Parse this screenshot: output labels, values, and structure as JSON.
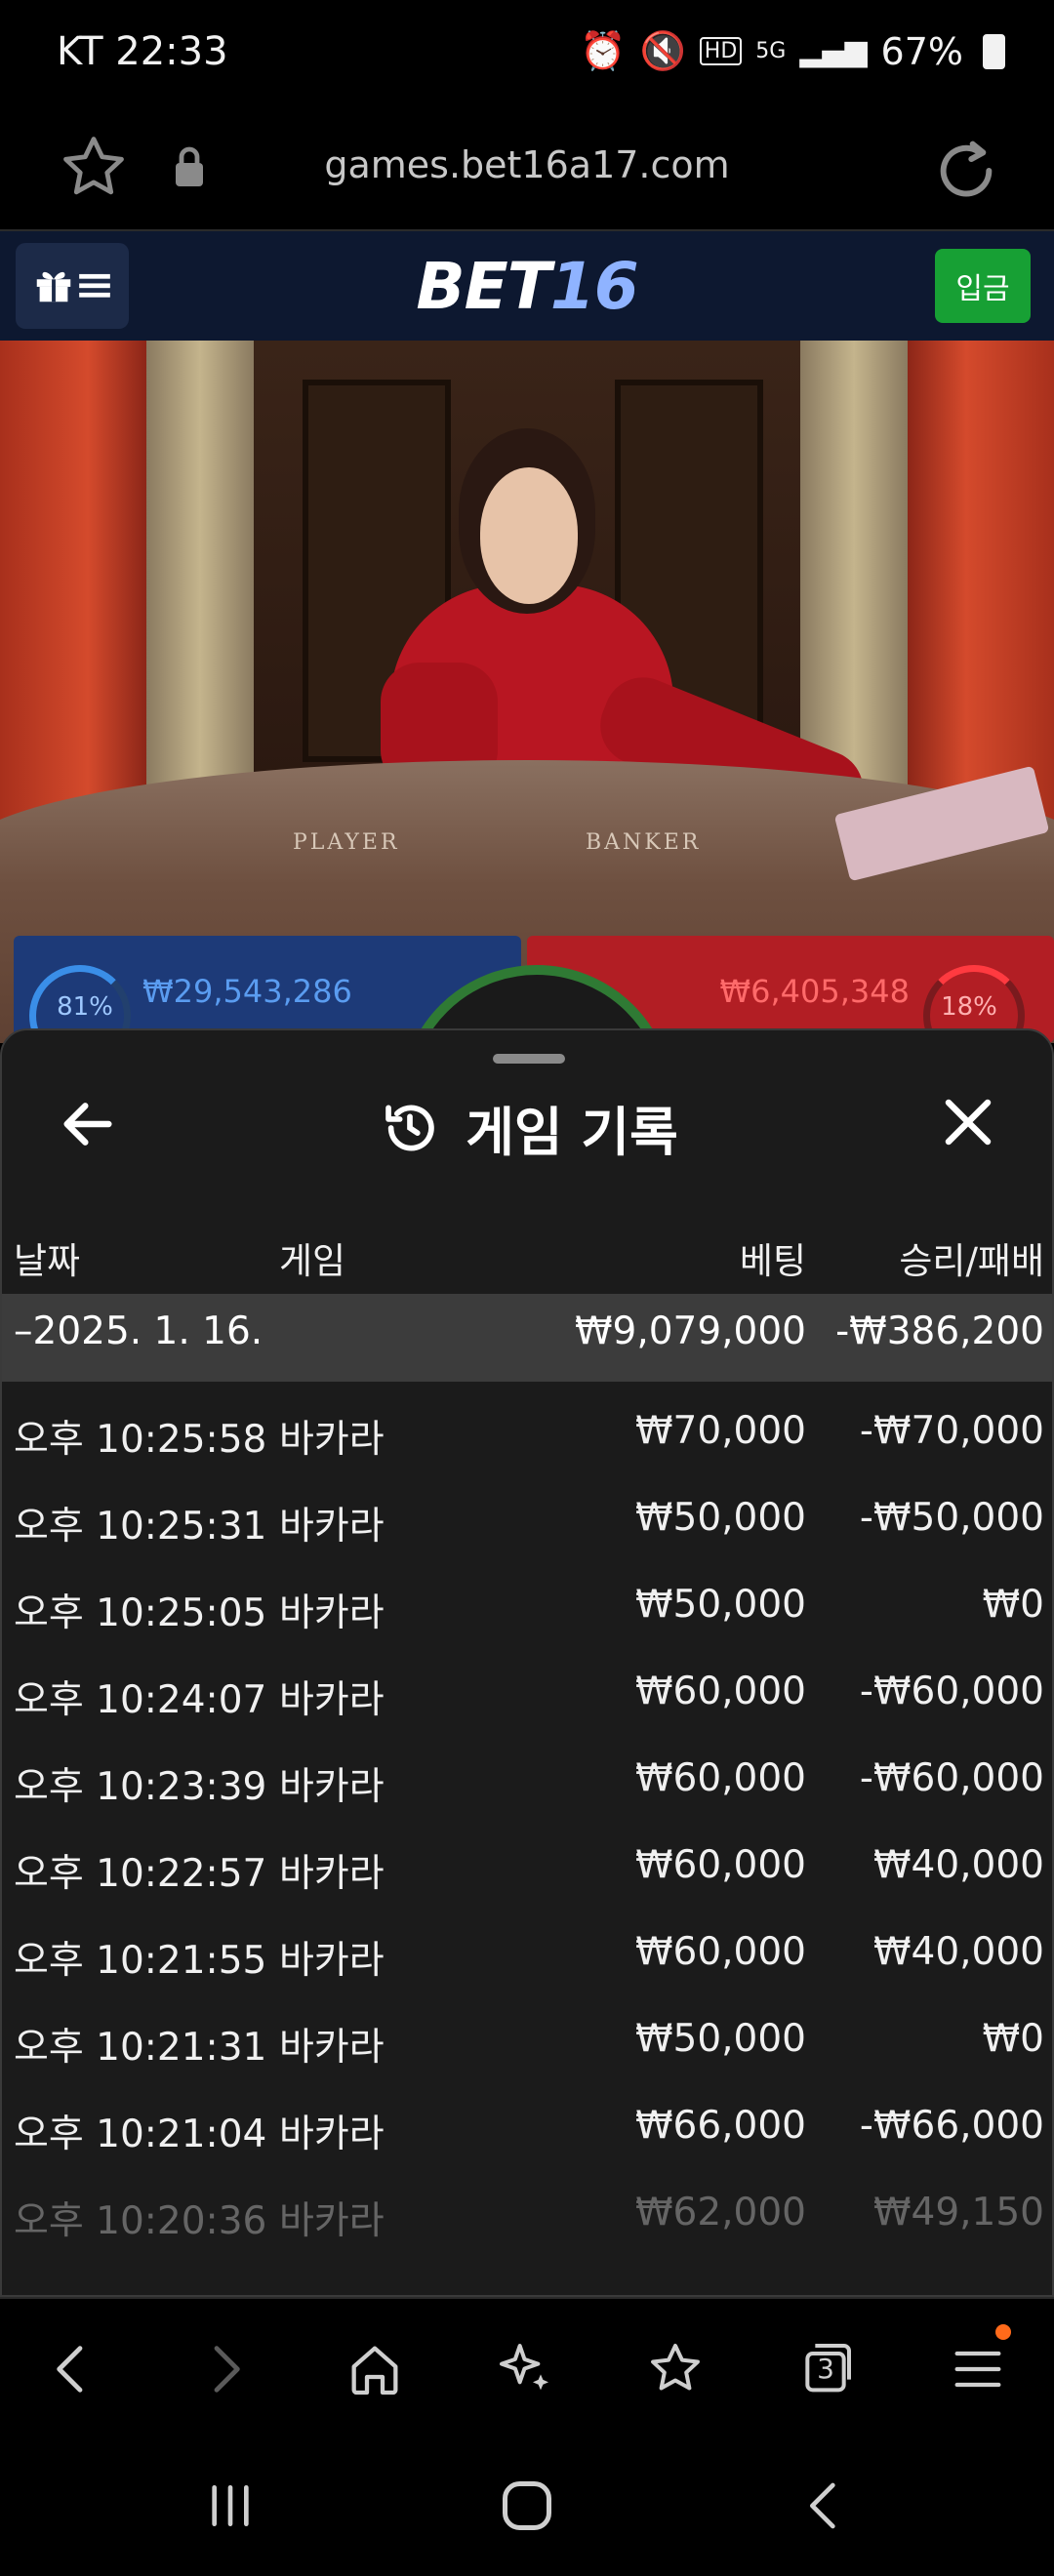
{
  "status_bar": {
    "time": "KT 22:33",
    "icons": [
      "alarm-icon",
      "mute-icon",
      "hd-icon",
      "5g-icon",
      "signal-icon"
    ],
    "battery": "67%"
  },
  "browser": {
    "url": "games.bet16a17.com",
    "toolbar_tabs_count": "3"
  },
  "site": {
    "logo_part1": "BET",
    "logo_part2": "16",
    "deposit_label": "입금"
  },
  "live_game": {
    "table_player_label": "PLAYER",
    "table_banker_label": "BANKER",
    "player_percent": "81%",
    "player_amount": "₩29,543,286",
    "banker_percent": "18%",
    "banker_amount": "₩6,405,348"
  },
  "history": {
    "title": "게임 기록",
    "columns": {
      "date": "날짜",
      "game": "게임",
      "bet": "베팅",
      "result": "승리/패배"
    },
    "summary": {
      "date": "–2025. 1. 16.",
      "bet": "₩9,079,000",
      "result": "-₩386,200"
    },
    "rows": [
      {
        "time": "오후 10:25:58",
        "game": "바카라",
        "bet": "₩70,000",
        "result": "-₩70,000"
      },
      {
        "time": "오후 10:25:31",
        "game": "바카라",
        "bet": "₩50,000",
        "result": "-₩50,000"
      },
      {
        "time": "오후 10:25:05",
        "game": "바카라",
        "bet": "₩50,000",
        "result": "₩0"
      },
      {
        "time": "오후 10:24:07",
        "game": "바카라",
        "bet": "₩60,000",
        "result": "-₩60,000"
      },
      {
        "time": "오후 10:23:39",
        "game": "바카라",
        "bet": "₩60,000",
        "result": "-₩60,000"
      },
      {
        "time": "오후 10:22:57",
        "game": "바카라",
        "bet": "₩60,000",
        "result": "₩40,000"
      },
      {
        "time": "오후 10:21:55",
        "game": "바카라",
        "bet": "₩60,000",
        "result": "₩40,000"
      },
      {
        "time": "오후 10:21:31",
        "game": "바카라",
        "bet": "₩50,000",
        "result": "₩0"
      },
      {
        "time": "오후 10:21:04",
        "game": "바카라",
        "bet": "₩66,000",
        "result": "-₩66,000"
      },
      {
        "time": "오후 10:20:36",
        "game": "바카라",
        "bet": "₩62,000",
        "result": "₩49,150"
      }
    ]
  },
  "colors": {
    "header_bg": "#0d1830",
    "deposit_green": "#17a034",
    "sheet_bg": "#1b1b1b",
    "summary_bg": "#3c3c3c",
    "player_blue": "#1d3a78",
    "banker_red": "#b21e24"
  }
}
